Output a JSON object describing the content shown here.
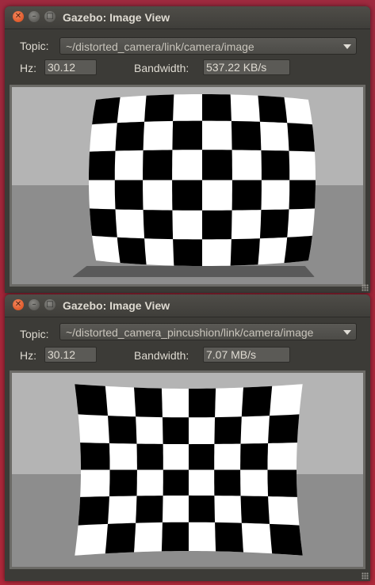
{
  "windows": [
    {
      "title": "Gazebo: Image View",
      "topic_label": "Topic:",
      "topic_value": "~/distorted_camera/link/camera/image",
      "hz_label": "Hz:",
      "hz_value": "30.12",
      "bandwidth_label": "Bandwidth:",
      "bandwidth_value": "537.22 KB/s",
      "distortion": "barrel"
    },
    {
      "title": "Gazebo: Image View",
      "topic_label": "Topic:",
      "topic_value": "~/distorted_camera_pincushion/link/camera/image",
      "hz_label": "Hz:",
      "hz_value": "30.12",
      "bandwidth_label": "Bandwidth:",
      "bandwidth_value": "7.07 MB/s",
      "distortion": "pincushion"
    }
  ],
  "icons": {
    "close": "close-icon",
    "minimize": "minimize-icon",
    "maximize": "maximize-icon",
    "dropdown": "chevron-down-icon",
    "resize": "resize-grip-icon"
  },
  "colors": {
    "desktop_background": "#a3263a",
    "window_background": "#3c3b37",
    "close_button": "#e05a2b",
    "text": "#dfdbd2"
  }
}
